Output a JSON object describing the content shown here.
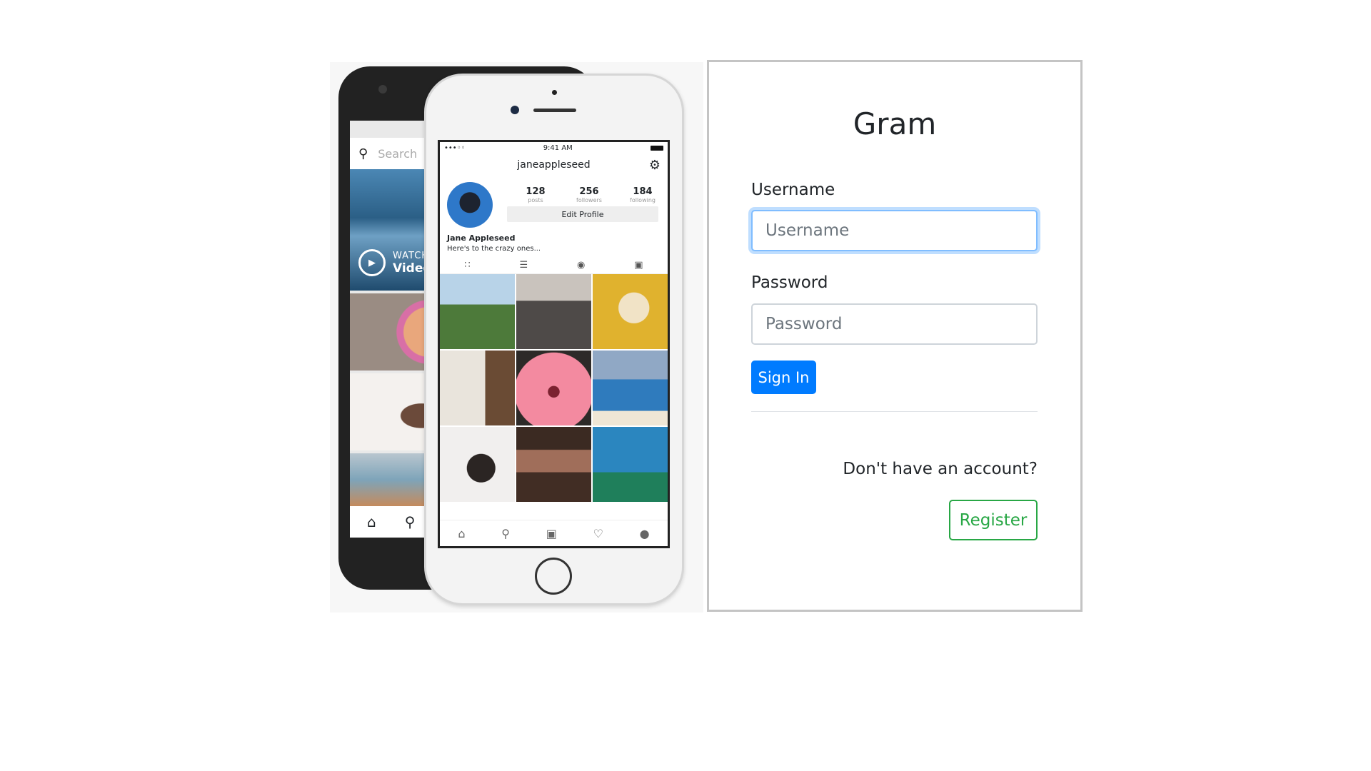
{
  "hero": {
    "back_phone": {
      "search_placeholder": "Search",
      "watch_label": "WATCH",
      "video_label": "Video"
    },
    "front_phone": {
      "time": "9:41 AM",
      "username": "janeappleseed",
      "stats": [
        {
          "value": "128",
          "label": "posts"
        },
        {
          "value": "256",
          "label": "followers"
        },
        {
          "value": "184",
          "label": "following"
        }
      ],
      "edit_profile_label": "Edit Profile",
      "display_name": "Jane Appleseed",
      "bio": "Here's to the crazy ones..."
    }
  },
  "login": {
    "title": "Gram",
    "username_label": "Username",
    "username_placeholder": "Username",
    "password_label": "Password",
    "password_placeholder": "Password",
    "signin_label": "Sign In",
    "no_account_text": "Don't have an account?",
    "register_label": "Register"
  },
  "colors": {
    "primary": "#007bff",
    "success": "#28a745",
    "card_border": "#c4c4c4",
    "focus_border": "#80bdff"
  }
}
